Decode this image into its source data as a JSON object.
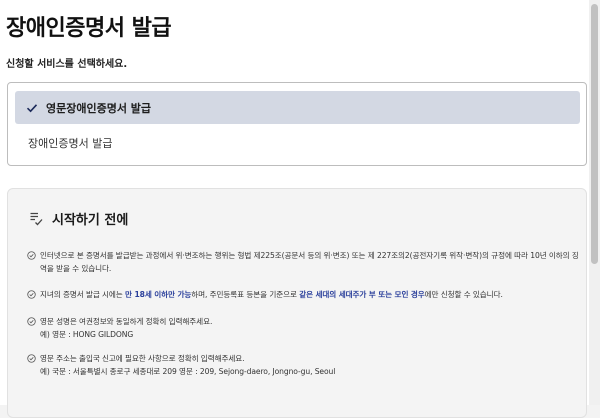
{
  "page": {
    "title": "장애인증명서 발급",
    "subtitle": "신청할 서비스를 선택하세요."
  },
  "options": {
    "selected": "영문장애인증명서 발급",
    "other": "장애인증명서 발급"
  },
  "info": {
    "heading": "시작하기 전에",
    "notices": [
      {
        "text": "인터넷으로 본 증명서를 발급받는 과정에서 위·변조하는 행위는 형법 제225조(공문서 등의 위·변조) 또는 제 227조의2(공전자기록 위작·변작)의 규정에 따라 10년 이하의 징역을 받을 수 있습니다."
      },
      {
        "pre": "지녀의 증명서 발급 시에는 ",
        "highlight1": "만 18세 이하만 가능",
        "mid": "하며, 주민등록표 등본을 기준으로 ",
        "highlight2": "같은 세대의 세대주가 부 또는 모인 경우",
        "post": "에만 신청할 수 있습니다."
      },
      {
        "line1": "영문 성명은 여권정보와 동일하게 정확히 입력해주세요.",
        "line2": "예) 영문 : HONG GILDONG"
      },
      {
        "line1": "영문 주소는 출입국 신고에 필요한 사항으로 정확히 입력해주세요.",
        "line2": "예) 국문 : 서울특별시 종로구 세종대로 209 영문 : 209, Sejong-daero, Jongno-gu, Seoul"
      }
    ]
  },
  "colors": {
    "selected_bg": "#d3d8e3",
    "highlight": "#2a3f9b"
  },
  "icons": [
    "check-icon",
    "document-check-icon",
    "circle-check-icon"
  ]
}
